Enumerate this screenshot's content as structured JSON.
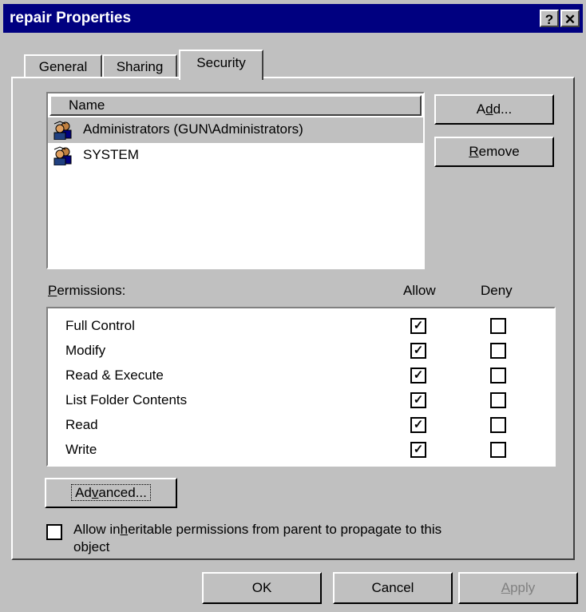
{
  "window": {
    "title": "repair Properties",
    "help_glyph": "?",
    "close_glyph": "✕"
  },
  "tabs": [
    {
      "label": "General",
      "active": false
    },
    {
      "label": "Sharing",
      "active": false
    },
    {
      "label": "Security",
      "active": true
    }
  ],
  "users": {
    "header": "Name",
    "items": [
      {
        "label": "Administrators (GUN\\Administrators)",
        "selected": true
      },
      {
        "label": "SYSTEM",
        "selected": false
      }
    ]
  },
  "buttons": {
    "add": {
      "pre": "A",
      "accel": "d",
      "post": "d..."
    },
    "remove": {
      "pre": "",
      "accel": "R",
      "post": "emove"
    },
    "advanced": {
      "pre": "Ad",
      "accel": "v",
      "post": "anced..."
    },
    "ok": "OK",
    "cancel": "Cancel",
    "apply": {
      "pre": "",
      "accel": "A",
      "post": "pply",
      "enabled": false
    }
  },
  "permissions": {
    "label_accel": "P",
    "label_rest": "ermissions:",
    "allow_header": "Allow",
    "deny_header": "Deny",
    "rows": [
      {
        "name": "Full Control",
        "allow": true,
        "deny": false
      },
      {
        "name": "Modify",
        "allow": true,
        "deny": false
      },
      {
        "name": "Read & Execute",
        "allow": true,
        "deny": false
      },
      {
        "name": "List Folder Contents",
        "allow": true,
        "deny": false
      },
      {
        "name": "Read",
        "allow": true,
        "deny": false
      },
      {
        "name": "Write",
        "allow": true,
        "deny": false
      }
    ]
  },
  "inherit": {
    "checked": false,
    "line1_pre": "Allow in",
    "line1_accel": "h",
    "line1_post": "eritable permissions from parent to propagate to this",
    "line2": "object"
  },
  "colors": {
    "titlebar": "#000080",
    "face": "#c0c0c0",
    "selection": "#c0c0c0"
  },
  "icons": {
    "user_group": "users-group-icon"
  }
}
